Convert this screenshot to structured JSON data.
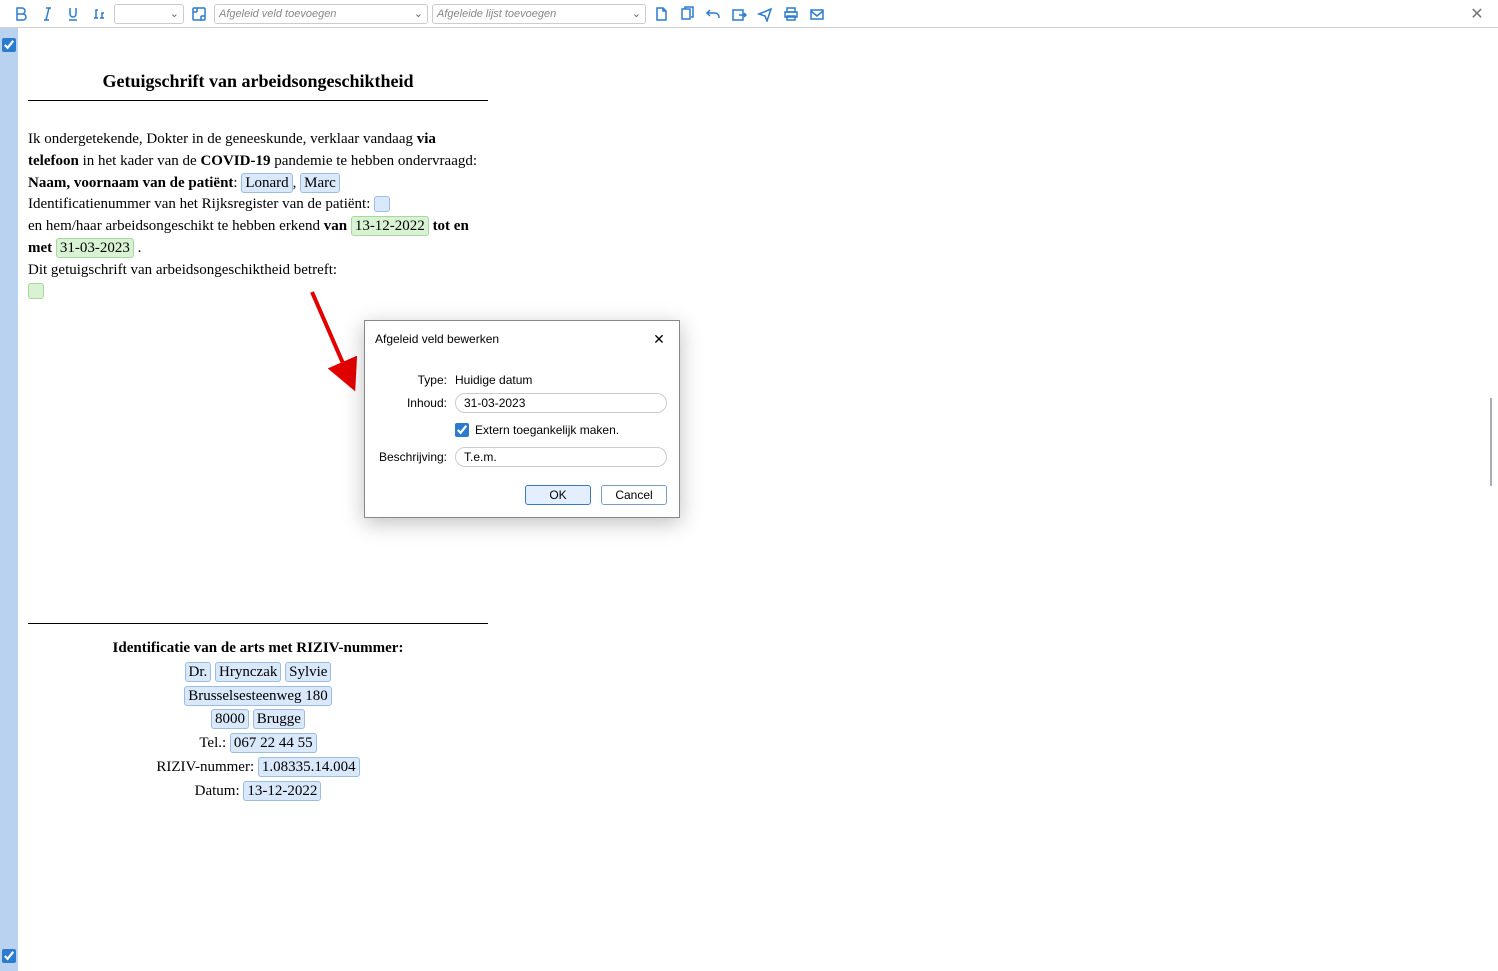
{
  "toolbar": {
    "dropdown_empty": "",
    "dropdown_field": "Afgeleid veld toevoegen",
    "dropdown_list": "Afgeleide lijst toevoegen"
  },
  "doc": {
    "title": "Getuigschrift van arbeidsongeschiktheid",
    "p1_a": "Ik ondergetekende, Dokter in de geneeskunde, verklaar vandaag ",
    "p1_b": "via telefoon",
    "p1_c": " in het kader van de ",
    "p1_d": "COVID-19",
    "p1_e": " pandemie te hebben ondervraagd:",
    "name_label": "Naam, voornaam van de patiënt",
    "name_val1": "Lonard",
    "name_sep": ", ",
    "name_val2": "Marc",
    "rrn_label": "Identificatienummer van het Rijksregister van de patiënt: ",
    "p2_a": "en hem/haar arbeidsongeschikt te hebben erkend ",
    "p2_van": "van",
    "date_from": "13-12-2022",
    "p2_tot": " tot en met ",
    "date_to": "31-03-2023",
    "p2_dot": " .",
    "p3": "Dit getuigschrift van arbeidsongeschiktheid betreft:"
  },
  "footer": {
    "header": "Identificatie van de arts met RIZIV-nummer:",
    "title": "Dr.",
    "lastname": "Hrynczak",
    "firstname": "Sylvie",
    "street": "Brusselsesteenweg 180",
    "zip": "8000",
    "city": "Brugge",
    "tel_label": "Tel.: ",
    "tel": "067 22 44 55",
    "riziv_label": "RIZIV-nummer: ",
    "riziv": "1.08335.14.004",
    "date_label": "Datum: ",
    "date": "13-12-2022"
  },
  "dialog": {
    "title": "Afgeleid veld bewerken",
    "type_label": "Type:",
    "type_value": "Huidige datum",
    "content_label": "Inhoud:",
    "content_value": "31-03-2023",
    "extern_label": "Extern toegankelijk maken.",
    "desc_label": "Beschrijving:",
    "desc_value": "T.e.m.",
    "ok": "OK",
    "cancel": "Cancel"
  }
}
